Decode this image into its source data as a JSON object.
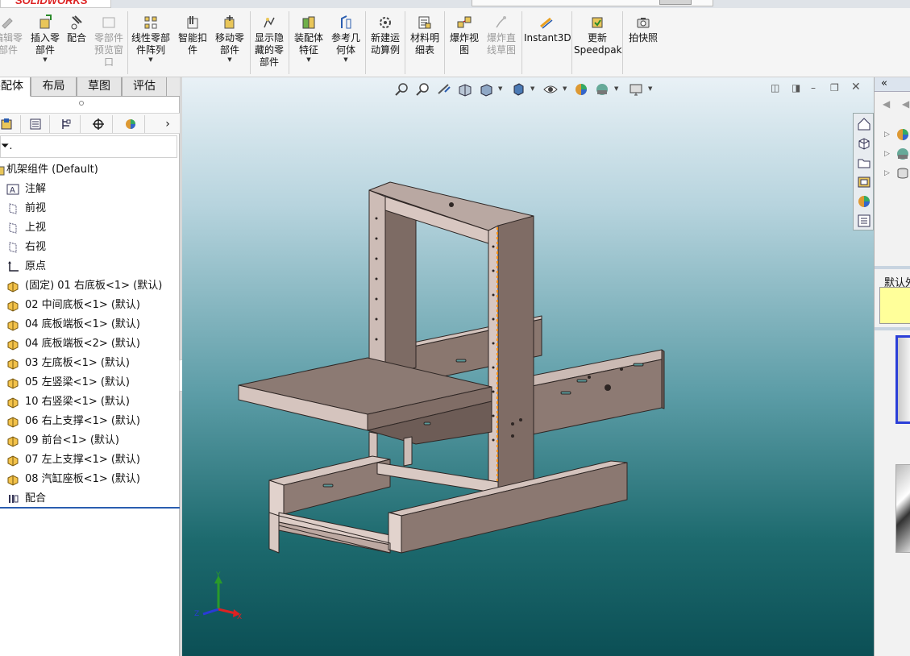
{
  "app": {
    "logo": "SOLIDWORKS",
    "brand_color": "#d22222"
  },
  "ribbon": {
    "edit_part": "编辑零\n部件",
    "insert_part": "插入零\n部件",
    "mate": "配合",
    "component_preview": "零部件\n预览窗\n口",
    "linear_pattern": "线性零部\n件阵列",
    "smart_fastener": "智能扣\n件",
    "move_component": "移动零\n部件",
    "show_hidden": "显示隐\n藏的零\n部件",
    "assembly_features": "装配体\n特征",
    "reference_geometry": "参考几\n何体",
    "new_motion_study": "新建运\n动算例",
    "bom": "材料明\n细表",
    "exploded_view": "爆炸视\n图",
    "explode_line": "爆炸直\n线草图",
    "instant3d": "Instant3D",
    "update_speedpak": "更新\nSpeedpak",
    "snapshot": "拍快照"
  },
  "tabs": [
    "装配体",
    "布局",
    "草图",
    "评估"
  ],
  "tree": {
    "root": "机架组件  (Default)",
    "items": [
      {
        "label": "注解",
        "icon": "annotation-icon"
      },
      {
        "label": "前视",
        "icon": "plane-icon"
      },
      {
        "label": "上视",
        "icon": "plane-icon"
      },
      {
        "label": "右视",
        "icon": "plane-icon"
      },
      {
        "label": "原点",
        "icon": "origin-icon"
      },
      {
        "label": "(固定) 01 右底板<1> (默认)",
        "icon": "part-icon"
      },
      {
        "label": "02 中间底板<1> (默认)",
        "icon": "part-icon"
      },
      {
        "label": "04 底板端板<1> (默认)",
        "icon": "part-icon"
      },
      {
        "label": "04 底板端板<2> (默认)",
        "icon": "part-icon"
      },
      {
        "label": "03 左底板<1> (默认)",
        "icon": "part-icon"
      },
      {
        "label": "05 左竖梁<1> (默认)",
        "icon": "part-icon"
      },
      {
        "label": "10 右竖梁<1> (默认)",
        "icon": "part-icon"
      },
      {
        "label": "06 右上支撑<1> (默认)",
        "icon": "part-icon"
      },
      {
        "label": "09 前台<1> (默认)",
        "icon": "part-icon"
      },
      {
        "label": "07 左上支撑<1> (默认)",
        "icon": "part-icon"
      },
      {
        "label": "08 汽缸座板<1> (默认)",
        "icon": "part-icon"
      },
      {
        "label": "配合",
        "icon": "mates-icon"
      }
    ]
  },
  "task_pane": {
    "label": "默认外观"
  },
  "colors": {
    "part_face": "#8d7a73",
    "part_edge": "#3a302d",
    "part_light": "#d9c8c2"
  }
}
